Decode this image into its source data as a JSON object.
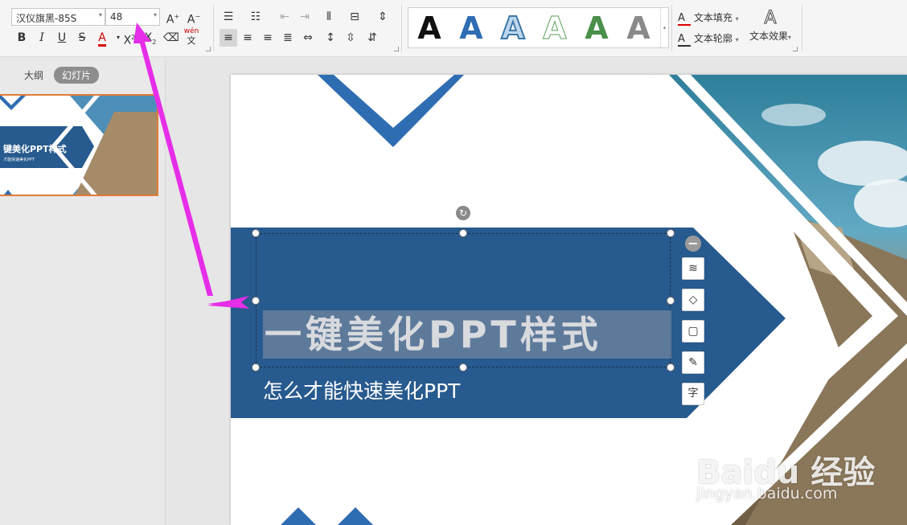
{
  "ribbon": {
    "font_name": "汉仪旗黑-85S",
    "font_size": "48",
    "phonetic_label": "wén",
    "text_fill_label": "文本填充",
    "text_outline_label": "文本轮廓",
    "text_effect_label": "文本效果",
    "art_styles": [
      {
        "glyph": "A",
        "style": "black-solid"
      },
      {
        "glyph": "A",
        "style": "blue-solid"
      },
      {
        "glyph": "A",
        "style": "blue-outline"
      },
      {
        "glyph": "A",
        "style": "green-outline"
      },
      {
        "glyph": "A",
        "style": "green-solid"
      },
      {
        "glyph": "A",
        "style": "gray-gradient"
      }
    ]
  },
  "left_pane": {
    "tabs": [
      "大纲",
      "幻灯片"
    ],
    "active_tab": "幻灯片",
    "thumbnail_title": "键美化PPT样式",
    "thumbnail_subtitle": "才能快速美化PPT"
  },
  "slide": {
    "title": "一键美化PPT样式",
    "subtitle": "怎么才能快速美化PPT"
  },
  "float_tools": [
    "collapse-icon",
    "layers-icon",
    "fill-icon",
    "frame-icon",
    "pen-icon",
    "text-wrap-icon"
  ],
  "watermark": {
    "brand": "Baidu 经验",
    "url": "jingyan.baidu.com"
  },
  "colors": {
    "slide_blue": "#275a8e",
    "accent_blue": "#2f6db3",
    "annotation_magenta": "#e62de8",
    "selection_orange": "#e07b39"
  }
}
